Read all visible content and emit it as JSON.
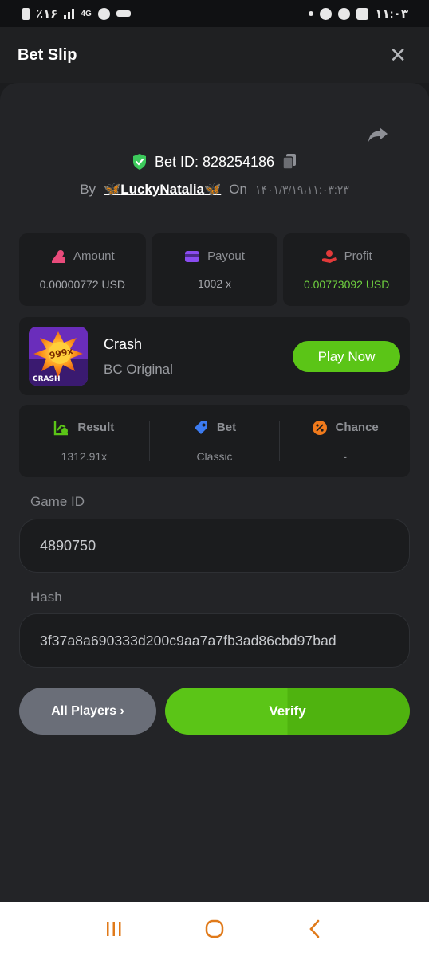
{
  "status_bar": {
    "left_text": "٪۱۶",
    "network": "4G",
    "time": "۱۱:۰۳"
  },
  "header": {
    "title": "Bet Slip",
    "close_symbol": "✕"
  },
  "bet": {
    "id_label": "Bet ID: 828254186",
    "by_label": "By",
    "username_prefix": "🦋",
    "username": "LuckyNatalia",
    "username_suffix": "🦋",
    "on_label": "On",
    "date": "۱۴۰۱/۳/۱۹،۱۱:۰۳:۲۳"
  },
  "stats": [
    {
      "label": "Amount",
      "value": "0.00000772 USD",
      "icon": "coins-icon",
      "color": "#e94b7b"
    },
    {
      "label": "Payout",
      "value": "1002 x",
      "icon": "card-icon",
      "color": "#8a4cf0"
    },
    {
      "label": "Profit",
      "value": "0.00773092 USD",
      "icon": "hand-coin-icon",
      "color": "#e23a3a"
    }
  ],
  "game": {
    "name": "Crash",
    "subtitle": "BC Original",
    "thumb_multiplier": "999x",
    "thumb_label": "CRASH",
    "play_label": "Play Now"
  },
  "result": {
    "columns": [
      {
        "label": "Result",
        "value": "1312.91x",
        "icon": "chart-check-icon",
        "color": "#5bc517"
      },
      {
        "label": "Bet",
        "value": "Classic",
        "icon": "tag-icon",
        "color": "#3c7bf0"
      },
      {
        "label": "Chance",
        "value": "-",
        "icon": "percent-icon",
        "color": "#f07a1c"
      }
    ]
  },
  "fields": {
    "game_id_label": "Game ID",
    "game_id_value": "4890750",
    "hash_label": "Hash",
    "hash_value": "3f37a8a690333d200c9aa7a7fb3ad86cbd97bad"
  },
  "buttons": {
    "all_players": "All Players ›",
    "verify": "Verify"
  },
  "colors": {
    "accent_green": "#5bc517",
    "background": "#1b1c1e",
    "sheet": "#232427"
  }
}
